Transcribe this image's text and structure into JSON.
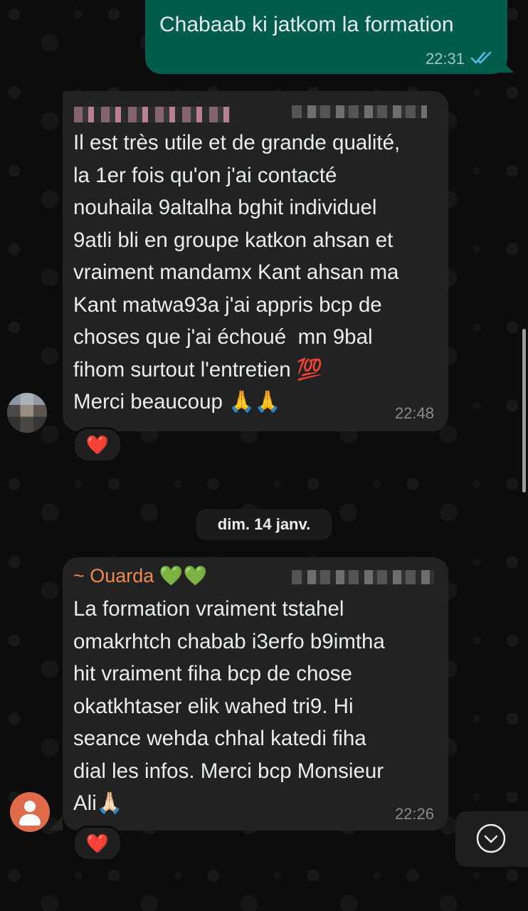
{
  "colors": {
    "outgoing_bubble": "#005c4b",
    "incoming_bubble": "#222222",
    "sender_name": "#f08a4c",
    "read_ticks": "#53bdeb",
    "reaction_heart": "#ff2d3a"
  },
  "messages": [
    {
      "direction": "outgoing",
      "text": "Chabaab ki jatkom la formation",
      "time": "22:31",
      "status_icon": "double-check-read-icon"
    },
    {
      "direction": "incoming",
      "sender": "",
      "text_lines": [
        "Il est très utile et de grande qualité,",
        "la 1er fois qu'on j'ai contacté",
        "nouhaila 9altalha bghit individuel",
        "9atli bli en groupe katkon ahsan et",
        "vraiment mandamx Kant ahsan ma",
        "Kant matwa93a j'ai appris bcp de",
        "choses que j'ai échoué  mn 9bal",
        "fihom surtout l'entretien 💯",
        "Merci beaucoup 🙏🙏"
      ],
      "time": "22:48",
      "reaction": "❤️"
    },
    {
      "direction": "incoming",
      "sender": "~ Ouarda 💚💚",
      "text_lines": [
        "La formation vraiment tstahel",
        "omakrhtch chabab i3erfo b9imtha",
        "hit vraiment fiha bcp de chose",
        "okatkhtaser elik wahed tri9. Hi",
        "seance wehda chhal katedi fiha",
        "dial les infos. Merci bcp Monsieur",
        "Ali🙏🏻"
      ],
      "time": "22:26",
      "reaction": "❤️"
    }
  ],
  "date_separator": "dim. 14 janv.",
  "icons": {
    "scroll_down": "chevron-down-icon",
    "default_avatar": "person-icon"
  }
}
